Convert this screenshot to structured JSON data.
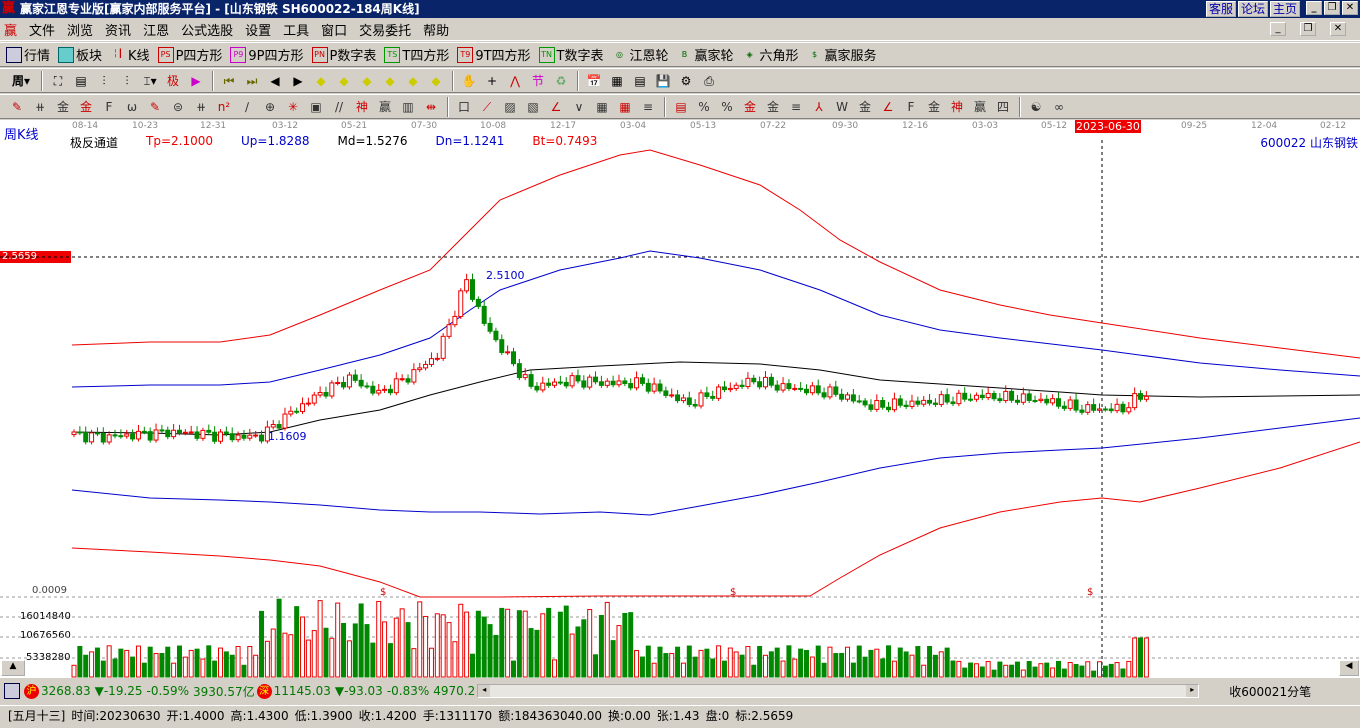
{
  "window": {
    "title": "赢家江恩专业版[赢家内部服务平台] - [山东钢铁   SH600022-184周K线]",
    "links": [
      "客服",
      "论坛",
      "主页"
    ]
  },
  "menu": [
    "文件",
    "浏览",
    "资讯",
    "江恩",
    "公式选股",
    "设置",
    "工具",
    "窗口",
    "交易委托",
    "帮助"
  ],
  "toolbar1": [
    {
      "icon": "PS",
      "label": "P四方形"
    },
    {
      "icon": "P9",
      "label": "9P四方形"
    },
    {
      "icon": "PN",
      "label": "P数字表"
    },
    {
      "icon": "TS",
      "label": "T四方形"
    },
    {
      "icon": "T9",
      "label": "9T四方形"
    },
    {
      "icon": "TN",
      "label": "T数字表"
    },
    {
      "icon": "◎",
      "label": "江恩轮"
    },
    {
      "icon": "B",
      "label": "赢家轮"
    },
    {
      "icon": "◈",
      "label": "六角形"
    },
    {
      "icon": "$",
      "label": "赢家服务"
    }
  ],
  "toolbar1_lead": [
    "行情",
    "板块",
    "K线"
  ],
  "period": "周",
  "chart": {
    "period_label": "周K线",
    "indicator": {
      "name": "极反通道",
      "tp": "Tp=2.1000",
      "up": "Up=1.8288",
      "md": "Md=1.5276",
      "dn": "Dn=1.1241",
      "bt": "Bt=0.7493"
    },
    "stock": "600022  山东钢铁",
    "dates": [
      "08-14",
      "10-23",
      "12-31",
      "03-12",
      "05-21",
      "07-30",
      "10-08",
      "12-17",
      "03-04",
      "05-13",
      "07-22",
      "09-30",
      "12-16",
      "03-03",
      "05-12",
      "2023-06-30",
      "09-25",
      "12-04",
      "02-12"
    ],
    "cursor_price": "2.5659",
    "high_label": "2.5100",
    "low_label": "1.1609",
    "bottom_label": "0.0009",
    "vol_ticks": [
      "16014840",
      "10676560",
      "5338280"
    ],
    "close_keypoints": [
      [
        0,
        1.18
      ],
      [
        5,
        1.16
      ],
      [
        17,
        1.2
      ],
      [
        29,
        1.16
      ],
      [
        32,
        1.17
      ],
      [
        37,
        1.35
      ],
      [
        42,
        1.5
      ],
      [
        47,
        1.62
      ],
      [
        52,
        1.5
      ],
      [
        57,
        1.63
      ],
      [
        62,
        1.8
      ],
      [
        67,
        2.38
      ],
      [
        70,
        2.05
      ],
      [
        73,
        1.85
      ],
      [
        78,
        1.55
      ],
      [
        85,
        1.6
      ],
      [
        92,
        1.58
      ],
      [
        97,
        1.58
      ],
      [
        100,
        1.52
      ],
      [
        105,
        1.42
      ],
      [
        110,
        1.52
      ],
      [
        116,
        1.6
      ],
      [
        121,
        1.55
      ],
      [
        130,
        1.5
      ],
      [
        136,
        1.4
      ],
      [
        145,
        1.43
      ],
      [
        155,
        1.48
      ],
      [
        165,
        1.45
      ],
      [
        172,
        1.38
      ],
      [
        179,
        1.38
      ],
      [
        181,
        1.45
      ],
      [
        183,
        1.5
      ]
    ]
  },
  "quotes": {
    "sh_index": "3268.83",
    "sh_chg": "▼-19.25",
    "sh_pct": "-0.59%",
    "sh_amt": "3930.57亿",
    "sz_index": "11145.03",
    "sz_chg": "▼-93.03",
    "sz_pct": "-0.83%",
    "sz_amt": "4970.2",
    "ticker": "收600021分笔",
    "sh": "沪",
    "sz": "深"
  },
  "status": [
    "[五月十三]",
    "时间:20230630",
    "开:1.4000",
    "高:1.4300",
    "低:1.3900",
    "收:1.4200",
    "手:1311170",
    "额:184363040.00",
    "换:0.00",
    "张:1.43",
    "盘:0",
    "标:2.5659"
  ]
}
